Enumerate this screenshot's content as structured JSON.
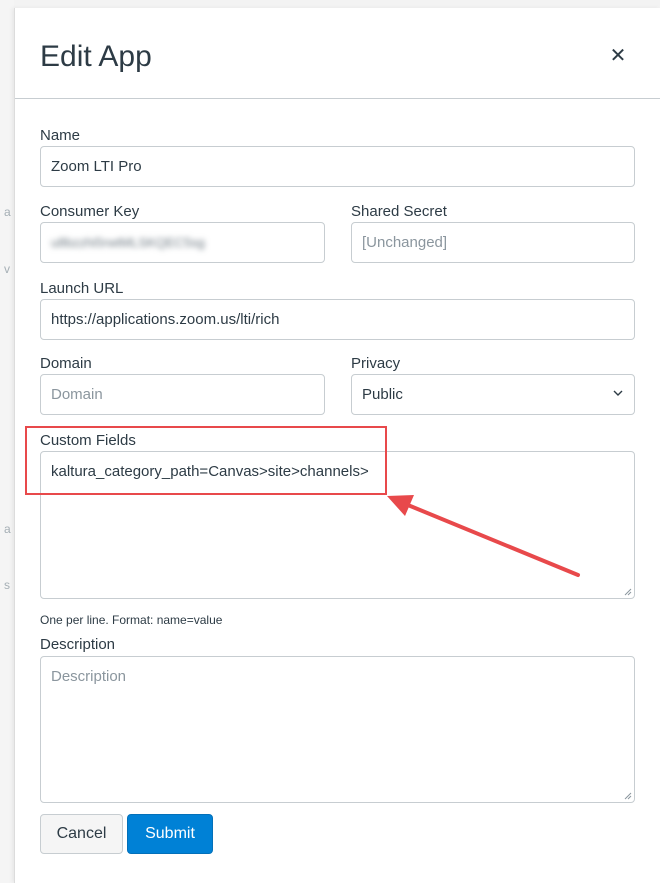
{
  "dialog": {
    "title": "Edit App",
    "close_icon": "close-icon"
  },
  "form": {
    "name": {
      "label": "Name",
      "value": "Zoom LTI Pro"
    },
    "consumer_key": {
      "label": "Consumer Key",
      "value": "u8bzzhi5rwtMLSKQEC5sg"
    },
    "shared_secret": {
      "label": "Shared Secret",
      "placeholder": "[Unchanged]"
    },
    "launch_url": {
      "label": "Launch URL",
      "value": "https://applications.zoom.us/lti/rich"
    },
    "domain": {
      "label": "Domain",
      "placeholder": "Domain"
    },
    "privacy": {
      "label": "Privacy",
      "selected": "Public"
    },
    "custom_fields": {
      "label": "Custom Fields",
      "value": "kaltura_category_path=Canvas>site>channels>",
      "hint": "One per line. Format: name=value"
    },
    "description": {
      "label": "Description",
      "placeholder": "Description"
    }
  },
  "actions": {
    "cancel_label": "Cancel",
    "submit_label": "Submit"
  },
  "annotation": {
    "color": "#e8494b"
  }
}
